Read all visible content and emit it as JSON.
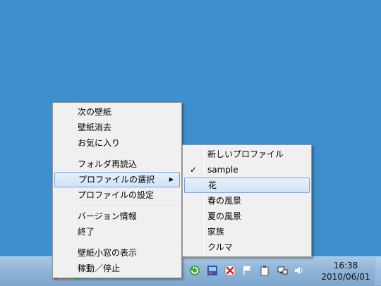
{
  "main_menu": {
    "items": [
      {
        "label": "次の壁紙"
      },
      {
        "label": "壁紙消去"
      },
      {
        "label": "お気に入り"
      },
      {
        "label": "フォルダ再読込"
      },
      {
        "label": "プロファイルの選択",
        "submenu": true,
        "highlighted": true
      },
      {
        "label": "プロファイルの設定"
      },
      {
        "label": "バージョン情報"
      },
      {
        "label": "終了"
      },
      {
        "label": "壁紙小窓の表示"
      },
      {
        "label": "稼動／停止"
      }
    ],
    "submenu_arrow": "▶"
  },
  "profile_submenu": {
    "items": [
      {
        "label": "新しいプロファイル"
      },
      {
        "label": "sample",
        "checked": true
      },
      {
        "label": "花",
        "highlighted": true
      },
      {
        "label": "春の風景"
      },
      {
        "label": "夏の風景"
      },
      {
        "label": "家族"
      },
      {
        "label": "クルマ"
      }
    ],
    "check_mark": "✓"
  },
  "taskbar": {
    "tray_icons": [
      "refresh-green-icon",
      "app-blue-icon",
      "close-red-icon",
      "flag-icon",
      "clipboard-icon",
      "network-icon",
      "volume-icon"
    ],
    "clock": {
      "time": "16:38",
      "date": "2010/06/01"
    }
  }
}
